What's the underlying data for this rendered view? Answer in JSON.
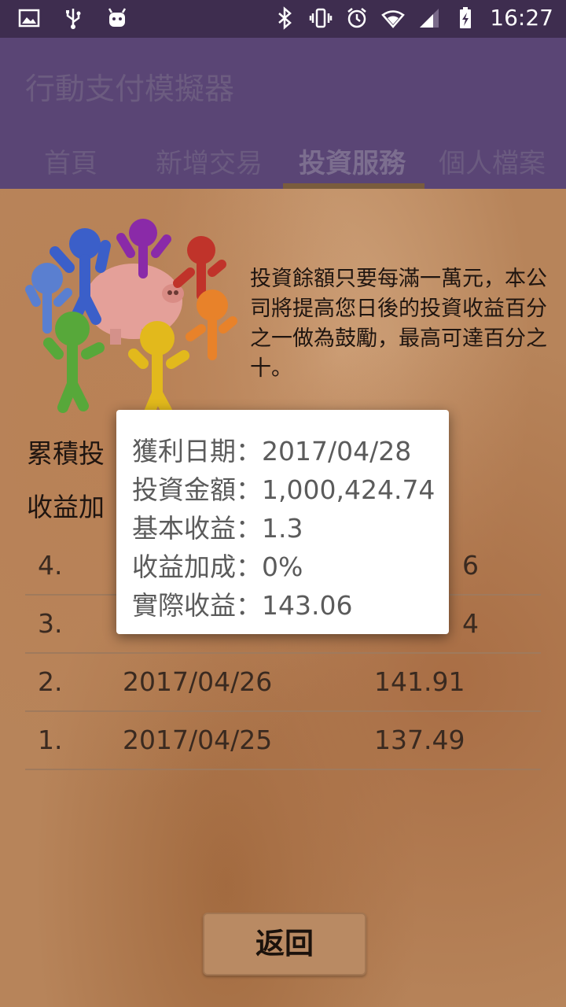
{
  "status_bar": {
    "time": "16:27",
    "left_icons": [
      "image-icon",
      "usb-icon",
      "android-icon"
    ],
    "right_icons": [
      "bluetooth-icon",
      "vibrate-icon",
      "alarm-icon",
      "wifi-icon",
      "signal-icon",
      "battery-charging-icon"
    ]
  },
  "app": {
    "title": "行動支付模擬器",
    "tabs": [
      {
        "label": "首頁",
        "active": false
      },
      {
        "label": "新增交易",
        "active": false
      },
      {
        "label": "投資服務",
        "active": true
      },
      {
        "label": "個人檔案",
        "active": false
      }
    ]
  },
  "promo_text": "投資餘額只要每滿一萬元，本公司將提高您日後的投資收益百分之一做為鼓勵，最高可達百分之十。",
  "summary": {
    "line1": "累積投",
    "line2": "收益加"
  },
  "history": [
    {
      "idx": "4.",
      "date": "",
      "value": "6"
    },
    {
      "idx": "3.",
      "date": "",
      "value": "4"
    },
    {
      "idx": "2.",
      "date": "2017/04/26",
      "value": "141.91"
    },
    {
      "idx": "1.",
      "date": "2017/04/25",
      "value": "137.49"
    }
  ],
  "back_button": "返回",
  "dialog": {
    "date": "獲利日期：2017/04/28",
    "amount": "投資金額：1,000,424.74",
    "base": "基本收益：1.3",
    "bonus": "收益加成：0%",
    "actual": "實際收益：143.06"
  },
  "colors": {
    "status_bar": "#3e2d4f",
    "app_bar": "#5a4575",
    "tab_indicator": "#7a5c3d",
    "dialog_bg": "#ffffff"
  }
}
